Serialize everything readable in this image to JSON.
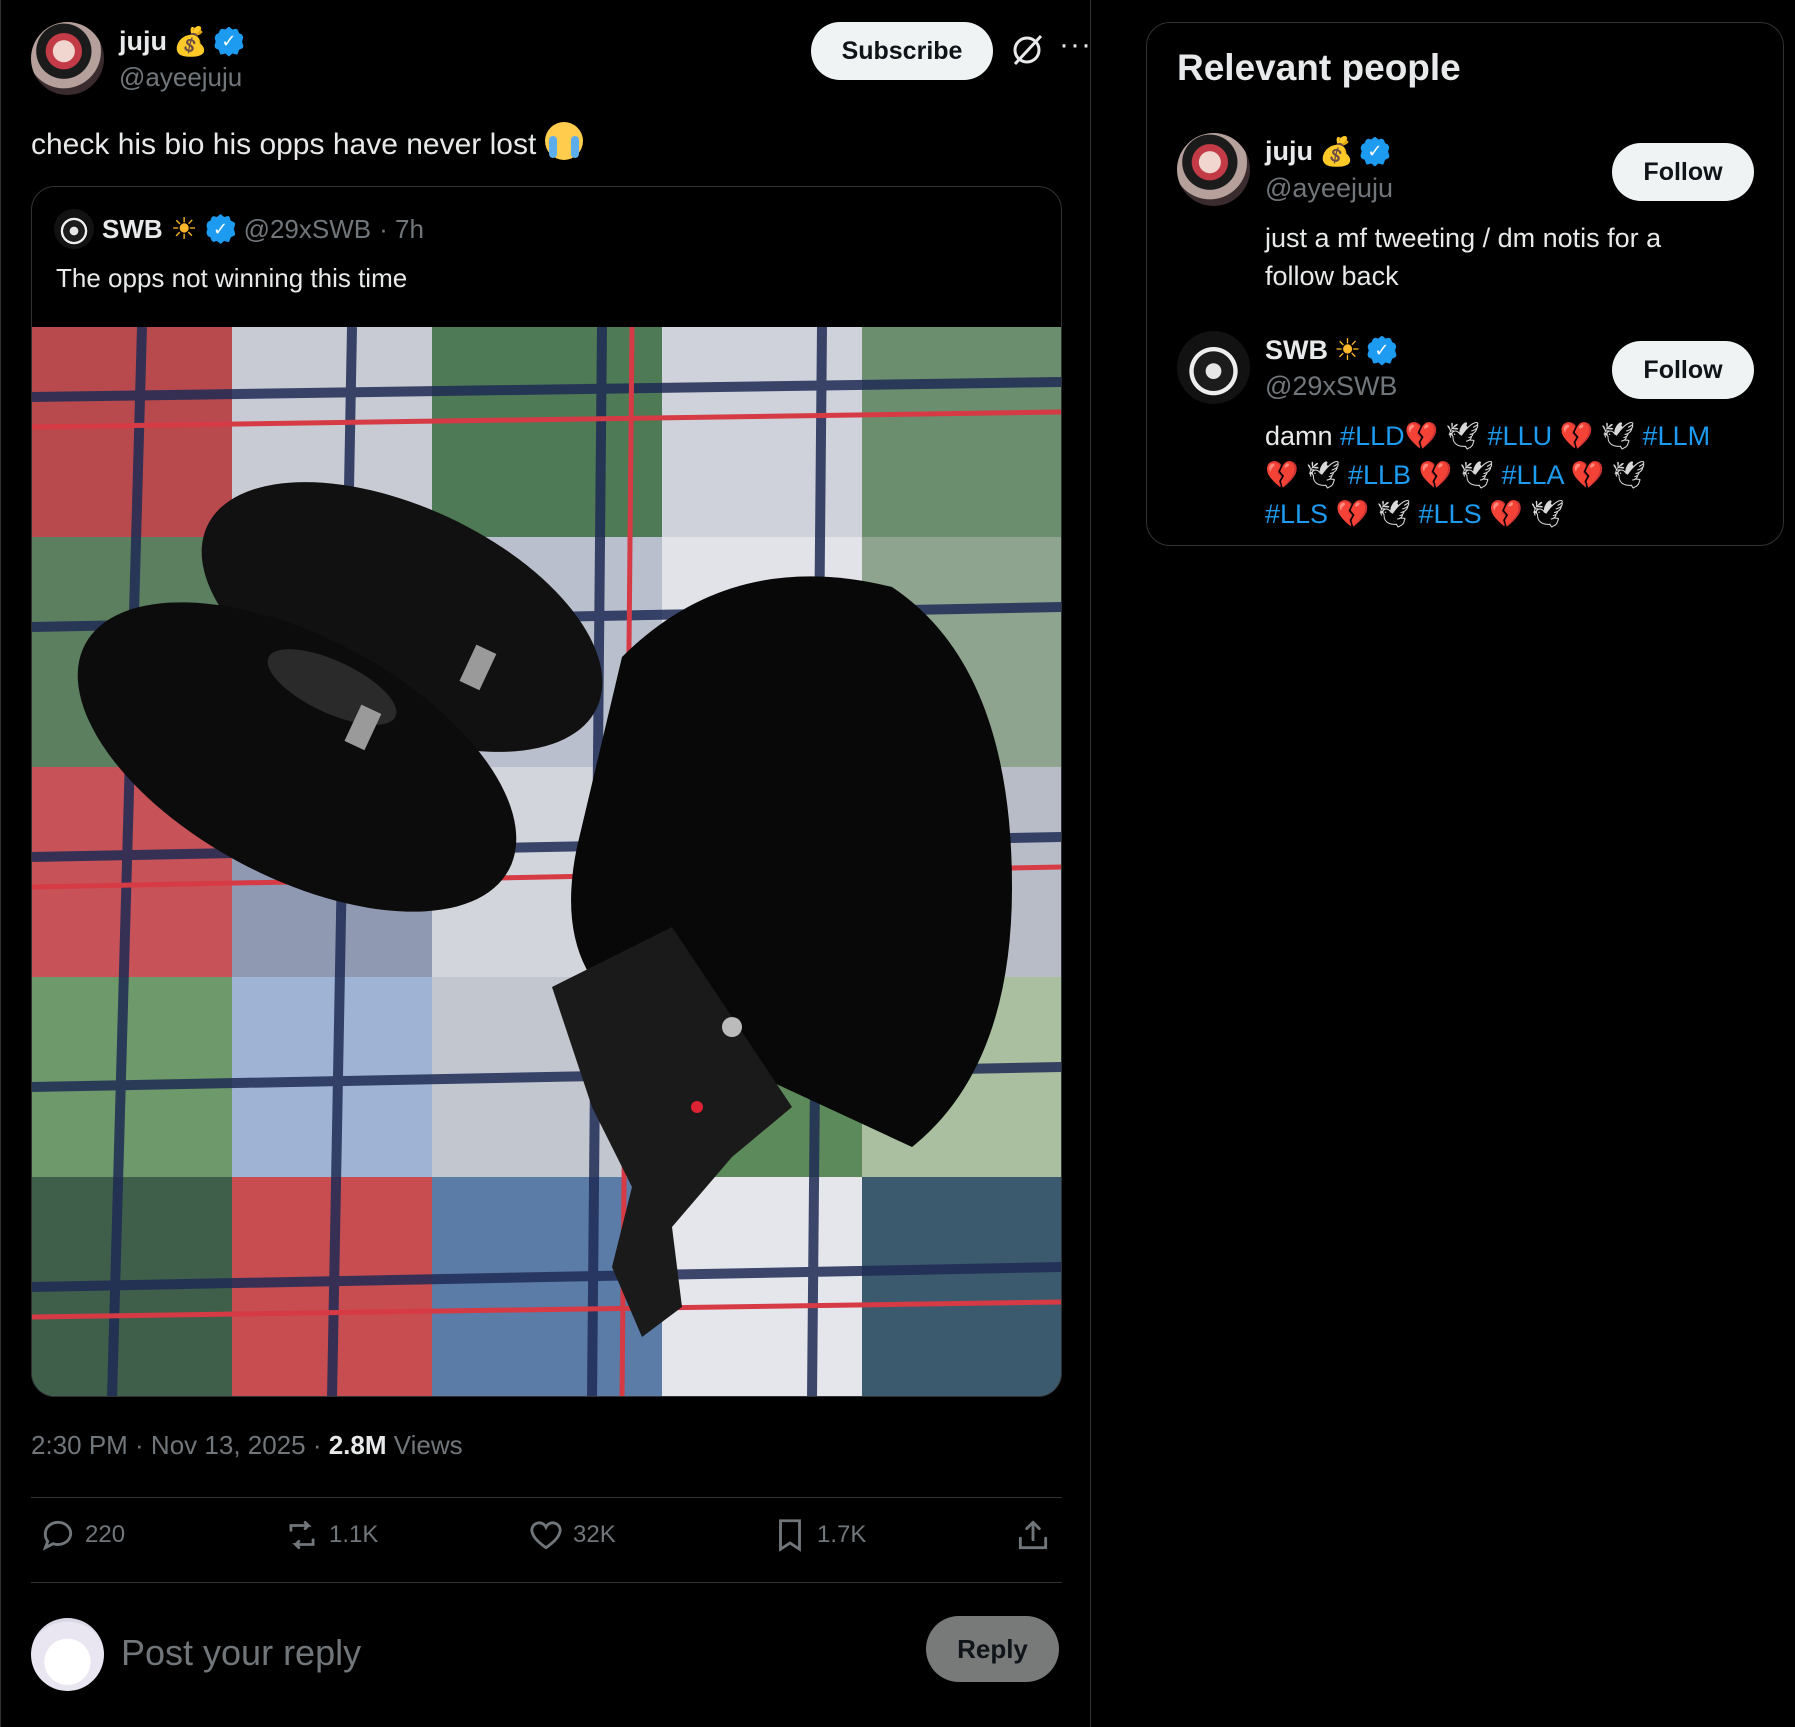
{
  "post": {
    "author_name": "juju",
    "author_emoji": "💰",
    "author_handle": "@ayeejuju",
    "subscribe_label": "Subscribe",
    "text": "check his bio his opps have never lost",
    "text_emoji": "😭",
    "timestamp": "2:30 PM · Nov 13, 2025 · ",
    "views_count": "2.8M",
    "views_label": " Views"
  },
  "quote": {
    "author_name": "SWB",
    "author_emoji": "☀",
    "author_handle": "@29xSWB",
    "age": "· 7h",
    "text": "The opps not winning this time"
  },
  "actions": {
    "replies": "220",
    "reposts": "1.1K",
    "likes": "32K",
    "bookmarks": "1.7K"
  },
  "reply": {
    "placeholder": "Post your reply",
    "button_label": "Reply"
  },
  "sidebar": {
    "title": "Relevant people",
    "people": [
      {
        "name": "juju",
        "emoji": "💰",
        "handle": "@ayeejuju",
        "follow_label": "Follow",
        "bio": "just a mf tweeting / dm notis for a follow back"
      },
      {
        "name": "SWB",
        "emoji": "☀",
        "handle": "@29xSWB",
        "follow_label": "Follow",
        "bio_prefix": "damn ",
        "tags": [
          "#LLD",
          "#LLU",
          "#LLM",
          "#LLB",
          "#LLA",
          "#LLS",
          "#LLS"
        ]
      }
    ]
  },
  "colors": {
    "accent": "#1d9bf0",
    "background": "#000000",
    "border": "#2f3336",
    "muted_text": "#71767b"
  }
}
